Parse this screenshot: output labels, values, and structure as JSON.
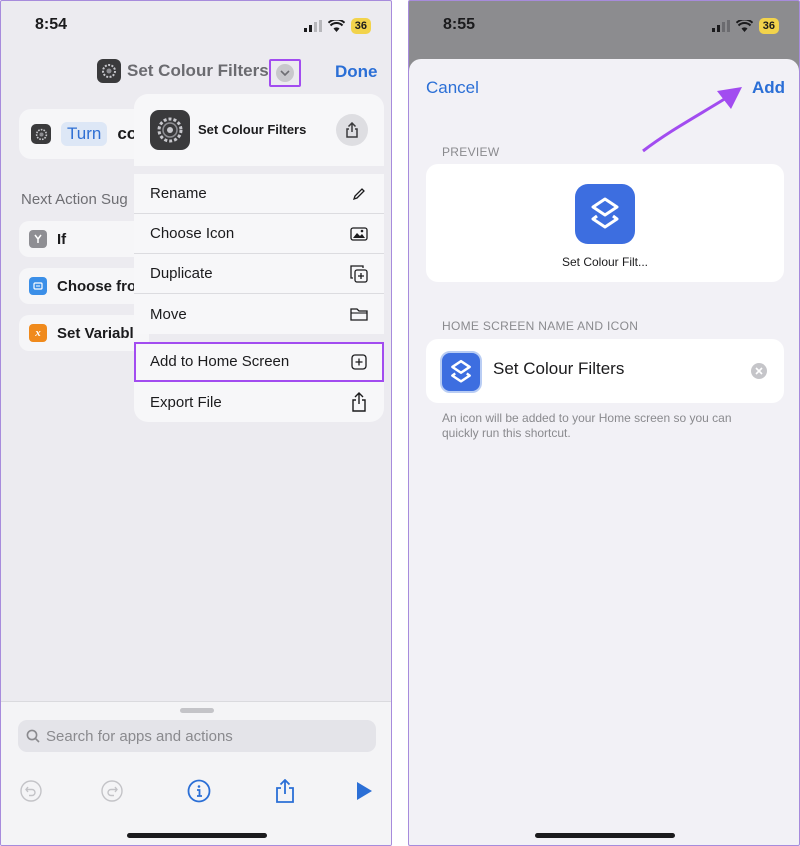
{
  "left": {
    "status": {
      "time": "8:54",
      "battery": "36"
    },
    "nav": {
      "title": "Set Colour Filters",
      "done": "Done"
    },
    "action": {
      "turn": "Turn",
      "rest": "co"
    },
    "suggestions": {
      "heading": "Next Action Sug",
      "items": [
        {
          "label": "If",
          "icon": "branch-icon",
          "color": "#8e8e93"
        },
        {
          "label": "Choose fro",
          "icon": "menu-list-icon",
          "color": "#3b8fe8"
        },
        {
          "label": "Set Variabl",
          "icon": "variable-icon",
          "color": "#f08a1c"
        }
      ]
    },
    "menu": {
      "title": "Set Colour Filters",
      "group1": [
        {
          "label": "Rename",
          "icon": "pencil-icon"
        },
        {
          "label": "Choose Icon",
          "icon": "image-icon"
        },
        {
          "label": "Duplicate",
          "icon": "duplicate-icon"
        },
        {
          "label": "Move",
          "icon": "folder-icon"
        }
      ],
      "add_home": "Add to Home Screen",
      "export": "Export File"
    },
    "search": {
      "placeholder": "Search for apps and actions"
    }
  },
  "right": {
    "status": {
      "time": "8:55",
      "battery": "36"
    },
    "cancel": "Cancel",
    "add": "Add",
    "preview_heading": "PREVIEW",
    "preview_name": "Set Colour Filt...",
    "name_heading": "HOME SCREEN NAME AND ICON",
    "name_value": "Set Colour Filters",
    "footnote": "An icon will be added to your Home screen so you can quickly run this shortcut."
  },
  "colors": {
    "accent": "#2b6fd6",
    "highlight": "#a24cf0",
    "icon_blue": "#3d6ee0"
  }
}
